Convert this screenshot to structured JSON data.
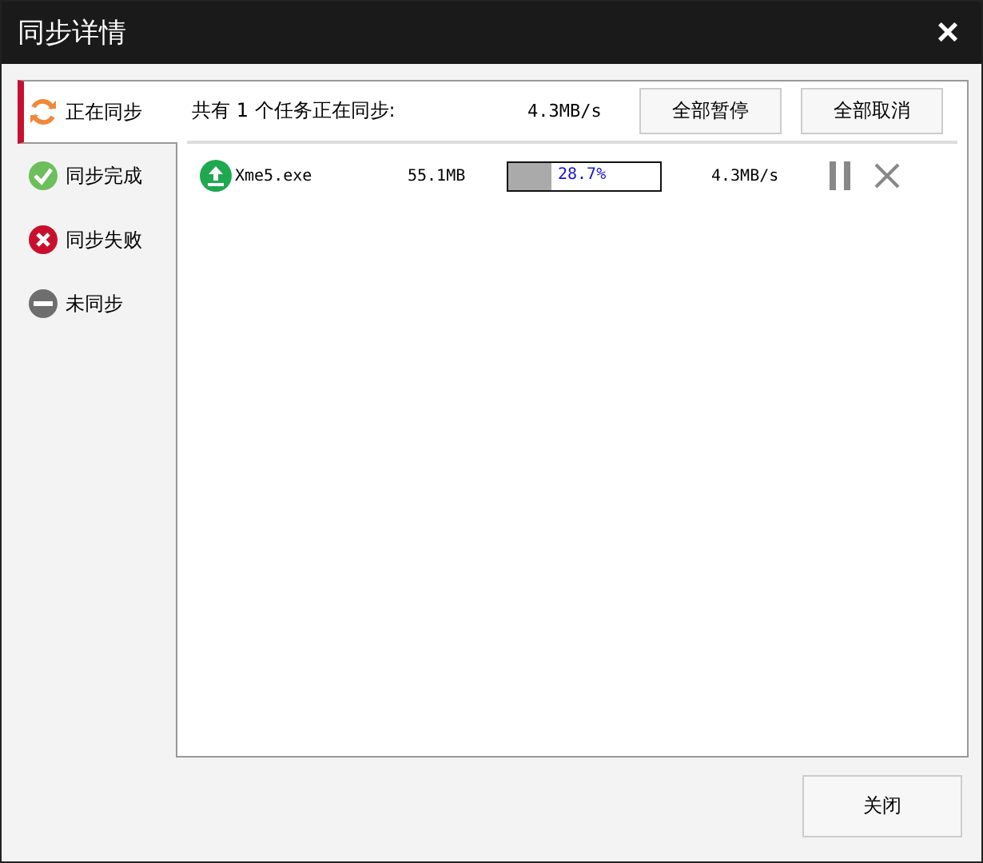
{
  "window": {
    "title": "同步详情",
    "close": "×"
  },
  "sidebar": {
    "items": [
      {
        "label": "正在同步",
        "kind": "syncing",
        "selected": true
      },
      {
        "label": "同步完成",
        "kind": "done",
        "selected": false
      },
      {
        "label": "同步失败",
        "kind": "failed",
        "selected": false
      },
      {
        "label": "未同步",
        "kind": "none",
        "selected": false
      }
    ]
  },
  "summary": {
    "text": "共有 1 个任务正在同步:",
    "speed": "4.3MB/s",
    "buttons": [
      "全部暂停",
      "全部取消"
    ]
  },
  "tasks": [
    {
      "name": "Xme5.exe",
      "size": "55.1MB",
      "level": 0.287,
      "percent": "28.7%",
      "speed": "4.3MB/s"
    }
  ],
  "footer": {
    "button": "关闭"
  }
}
